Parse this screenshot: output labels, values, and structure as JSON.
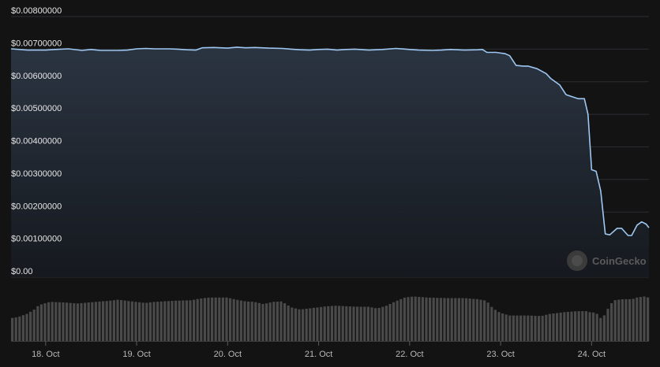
{
  "watermark": "CoinGecko",
  "chart_data": {
    "type": "area",
    "ylim": [
      0,
      0.008
    ],
    "ytick_values": [
      0,
      0.001,
      0.002,
      0.003,
      0.004,
      0.005,
      0.006,
      0.007,
      0.008
    ],
    "ytick_labels": [
      "$0.00",
      "$0.00100000",
      "$0.00200000",
      "$0.00300000",
      "$0.00400000",
      "$0.00500000",
      "$0.00600000",
      "$0.00700000",
      "$0.00800000"
    ],
    "xtick_labels": [
      "18. Oct",
      "19. Oct",
      "20. Oct",
      "21. Oct",
      "22. Oct",
      "23. Oct",
      "24. Oct"
    ],
    "xtick_values": [
      1,
      2,
      3,
      4,
      5,
      6,
      7
    ],
    "xlim": [
      0.62,
      7.63
    ],
    "grid": true,
    "colors": {
      "line": "#9ec8f2",
      "volume": "#4a4a4a",
      "grid": "#2a2d33",
      "background": "#131313"
    },
    "series": [
      {
        "values": [
          [
            0.62,
            0.00701
          ],
          [
            0.8,
            0.00697
          ],
          [
            1.0,
            0.00697
          ],
          [
            1.1,
            0.00699
          ],
          [
            1.25,
            0.00701
          ],
          [
            1.4,
            0.00696
          ],
          [
            1.5,
            0.00699
          ],
          [
            1.6,
            0.00696
          ],
          [
            1.8,
            0.00696
          ],
          [
            1.9,
            0.00697
          ],
          [
            2.0,
            0.00701
          ],
          [
            2.1,
            0.00702
          ],
          [
            2.2,
            0.00701
          ],
          [
            2.35,
            0.00701
          ],
          [
            2.45,
            0.007
          ],
          [
            2.55,
            0.00698
          ],
          [
            2.65,
            0.00697
          ],
          [
            2.72,
            0.00704
          ],
          [
            2.85,
            0.00705
          ],
          [
            3.0,
            0.00703
          ],
          [
            3.1,
            0.00706
          ],
          [
            3.2,
            0.00704
          ],
          [
            3.3,
            0.00705
          ],
          [
            3.45,
            0.00703
          ],
          [
            3.6,
            0.00702
          ],
          [
            3.7,
            0.007
          ],
          [
            3.8,
            0.00698
          ],
          [
            3.9,
            0.00697
          ],
          [
            4.0,
            0.00699
          ],
          [
            4.1,
            0.007
          ],
          [
            4.2,
            0.00697
          ],
          [
            4.3,
            0.00699
          ],
          [
            4.4,
            0.007
          ],
          [
            4.55,
            0.00697
          ],
          [
            4.7,
            0.00699
          ],
          [
            4.85,
            0.00702
          ],
          [
            5.0,
            0.00699
          ],
          [
            5.1,
            0.00697
          ],
          [
            5.25,
            0.00696
          ],
          [
            5.35,
            0.00697
          ],
          [
            5.45,
            0.00699
          ],
          [
            5.6,
            0.00697
          ],
          [
            5.75,
            0.00698
          ],
          [
            5.8,
            0.00699
          ],
          [
            5.85,
            0.0069
          ],
          [
            5.95,
            0.0069
          ],
          [
            6.05,
            0.00686
          ],
          [
            6.1,
            0.0068
          ],
          [
            6.17,
            0.0065
          ],
          [
            6.25,
            0.00648
          ],
          [
            6.3,
            0.00648
          ],
          [
            6.4,
            0.0064
          ],
          [
            6.5,
            0.00625
          ],
          [
            6.55,
            0.0061
          ],
          [
            6.65,
            0.0059
          ],
          [
            6.72,
            0.0056
          ],
          [
            6.85,
            0.00548
          ],
          [
            6.92,
            0.00548
          ],
          [
            6.96,
            0.005
          ],
          [
            7.0,
            0.0033
          ],
          [
            7.05,
            0.00325
          ],
          [
            7.1,
            0.00265
          ],
          [
            7.15,
            0.00133
          ],
          [
            7.2,
            0.0013
          ],
          [
            7.28,
            0.0015
          ],
          [
            7.33,
            0.0015
          ],
          [
            7.4,
            0.00128
          ],
          [
            7.44,
            0.00128
          ],
          [
            7.5,
            0.0016
          ],
          [
            7.55,
            0.0017
          ],
          [
            7.6,
            0.00163
          ],
          [
            7.63,
            0.00152
          ]
        ]
      }
    ],
    "volume_relative": [
      [
        0.62,
        0.42
      ],
      [
        0.7,
        0.44
      ],
      [
        0.8,
        0.5
      ],
      [
        0.88,
        0.58
      ],
      [
        0.93,
        0.66
      ],
      [
        1.05,
        0.72
      ],
      [
        1.2,
        0.71
      ],
      [
        1.35,
        0.69
      ],
      [
        1.55,
        0.72
      ],
      [
        1.7,
        0.74
      ],
      [
        1.8,
        0.76
      ],
      [
        1.9,
        0.74
      ],
      [
        2.0,
        0.72
      ],
      [
        2.1,
        0.7
      ],
      [
        2.2,
        0.72
      ],
      [
        2.4,
        0.74
      ],
      [
        2.6,
        0.75
      ],
      [
        2.7,
        0.78
      ],
      [
        2.8,
        0.8
      ],
      [
        3.0,
        0.8
      ],
      [
        3.1,
        0.76
      ],
      [
        3.2,
        0.73
      ],
      [
        3.3,
        0.72
      ],
      [
        3.4,
        0.68
      ],
      [
        3.5,
        0.72
      ],
      [
        3.6,
        0.73
      ],
      [
        3.7,
        0.62
      ],
      [
        3.8,
        0.58
      ],
      [
        3.9,
        0.6
      ],
      [
        4.0,
        0.62
      ],
      [
        4.1,
        0.64
      ],
      [
        4.2,
        0.65
      ],
      [
        4.3,
        0.64
      ],
      [
        4.45,
        0.63
      ],
      [
        4.55,
        0.63
      ],
      [
        4.65,
        0.6
      ],
      [
        4.75,
        0.65
      ],
      [
        4.85,
        0.73
      ],
      [
        4.95,
        0.8
      ],
      [
        5.05,
        0.82
      ],
      [
        5.2,
        0.8
      ],
      [
        5.4,
        0.79
      ],
      [
        5.6,
        0.79
      ],
      [
        5.75,
        0.77
      ],
      [
        5.85,
        0.74
      ],
      [
        5.92,
        0.6
      ],
      [
        6.0,
        0.52
      ],
      [
        6.1,
        0.47
      ],
      [
        6.3,
        0.47
      ],
      [
        6.45,
        0.46
      ],
      [
        6.55,
        0.5
      ],
      [
        6.7,
        0.53
      ],
      [
        6.85,
        0.55
      ],
      [
        6.95,
        0.55
      ],
      [
        7.0,
        0.52
      ],
      [
        7.05,
        0.53
      ],
      [
        7.1,
        0.42
      ],
      [
        7.15,
        0.48
      ],
      [
        7.2,
        0.65
      ],
      [
        7.25,
        0.75
      ],
      [
        7.35,
        0.77
      ],
      [
        7.45,
        0.77
      ],
      [
        7.5,
        0.8
      ],
      [
        7.58,
        0.82
      ],
      [
        7.63,
        0.8
      ]
    ]
  }
}
